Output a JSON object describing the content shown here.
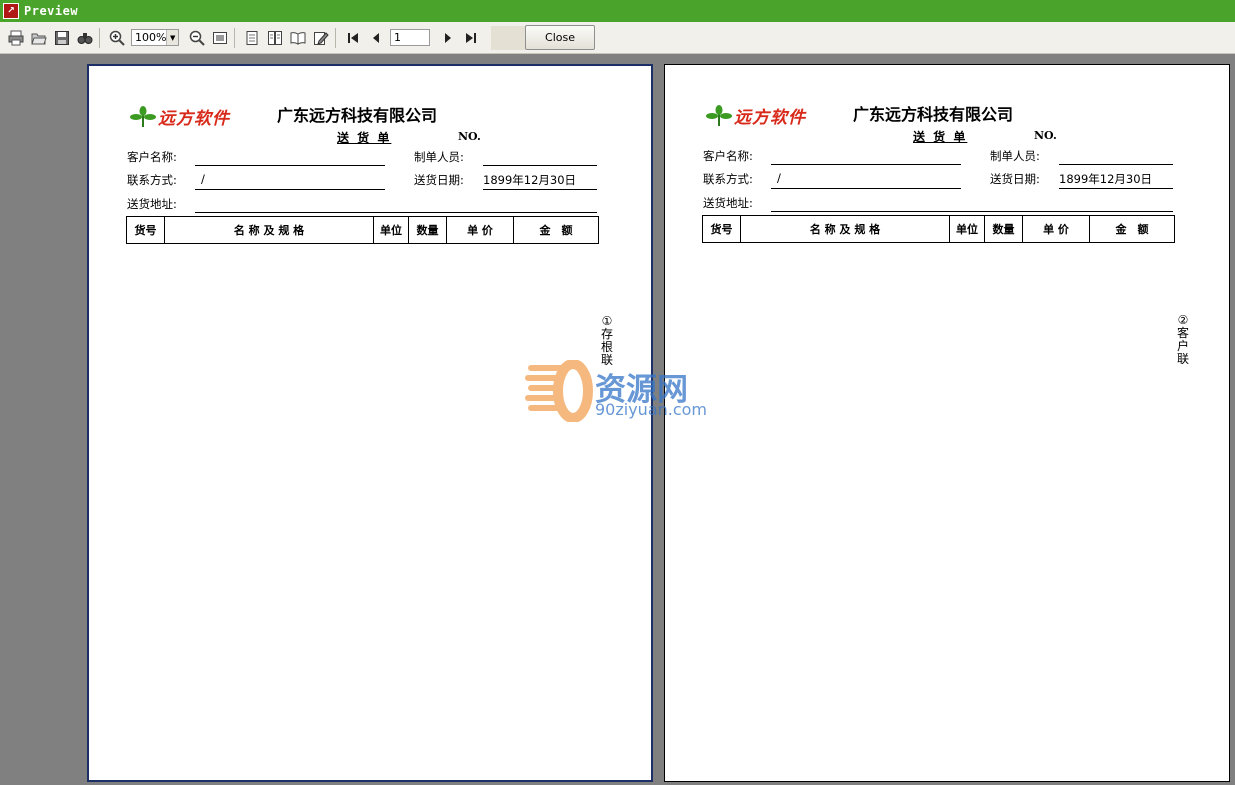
{
  "window": {
    "title": "Preview"
  },
  "toolbar": {
    "zoom_value": "100%",
    "page_value": "1",
    "close_label": "Close",
    "icons": [
      "printer-icon",
      "open-folder-icon",
      "save-icon",
      "find-icon",
      "zoom-in-icon",
      "zoom-out-icon",
      "fit-page-icon",
      "single-page-icon",
      "two-page-icon",
      "book-icon",
      "edit-icon",
      "first-page-icon",
      "previous-page-icon",
      "next-page-icon",
      "last-page-icon"
    ]
  },
  "form": {
    "brand": "远方软件",
    "company": "广东远方科技有限公司",
    "doc_title": "送 货 单",
    "no_label": "NO.",
    "customer_label": "客户名称:",
    "maker_label": "制单人员:",
    "contact_label": "联系方式:",
    "contact_value": "/",
    "date_label": "送货日期:",
    "date_value": "1899年12月30日",
    "address_label": "送货地址:",
    "columns": [
      "货号",
      "名 称 及 规 格",
      "单位",
      "数量",
      "单 价",
      "金　额"
    ],
    "brand_color": "#d82a1b"
  },
  "pages": [
    {
      "copy_mark": "①",
      "copy_label": [
        "存",
        "根",
        "联"
      ]
    },
    {
      "copy_mark": "②",
      "copy_label": [
        "客",
        "户",
        "联"
      ]
    }
  ],
  "watermark": {
    "name": "资源网",
    "url": "90ziyuan.com",
    "color": "#3575c8"
  },
  "colors": {
    "titlebar": "#4aa32a",
    "workspace": "#808080"
  }
}
